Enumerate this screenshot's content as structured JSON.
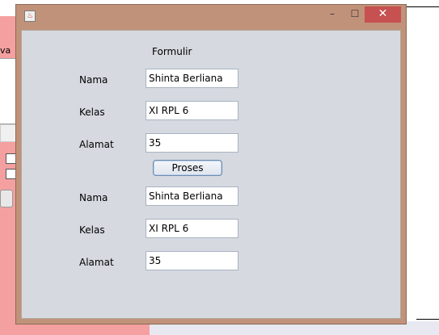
{
  "window": {
    "icon": "java-cup-icon",
    "controls": {
      "minimize": "–",
      "maximize": "☐",
      "close": "✕"
    }
  },
  "background": {
    "label_fragment": "va"
  },
  "form": {
    "title": "Formulir",
    "input": {
      "nama_label": "Nama",
      "nama_value": "Shinta Berliana",
      "kelas_label": "Kelas",
      "kelas_value": "XI RPL 6",
      "alamat_label": "Alamat",
      "alamat_value": "35"
    },
    "button_label": "Proses",
    "output": {
      "nama_label": "Nama",
      "nama_value": "Shinta Berliana",
      "kelas_label": "Kelas",
      "kelas_value": "XI RPL 6",
      "alamat_label": "Alamat",
      "alamat_value": "35"
    }
  }
}
